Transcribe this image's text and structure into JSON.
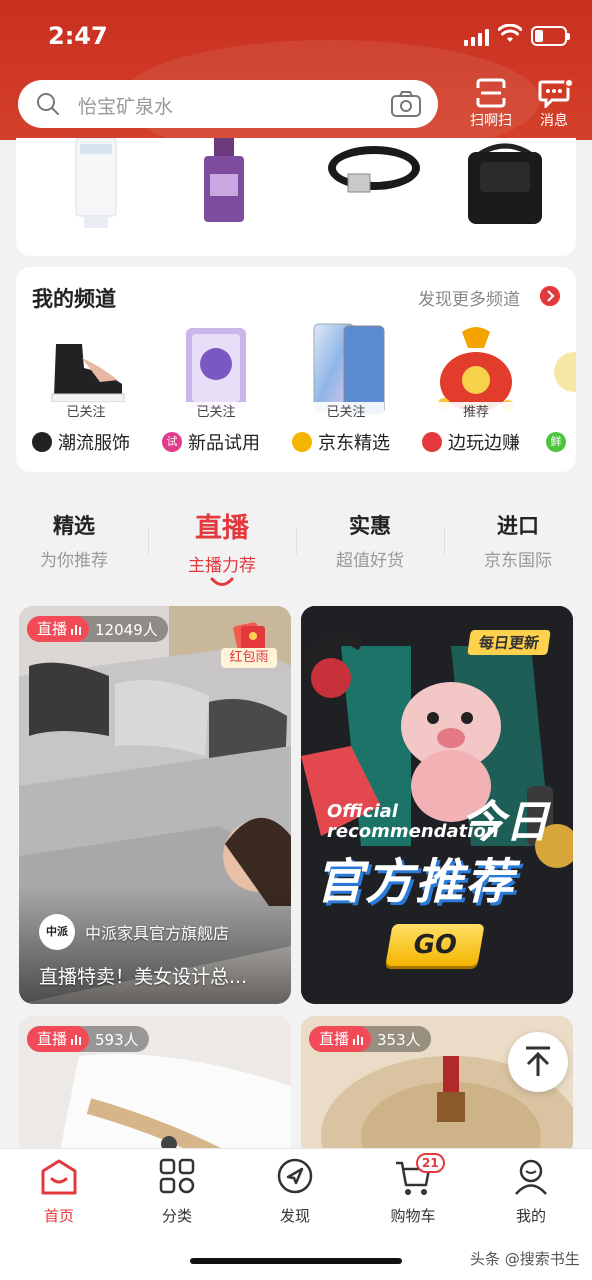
{
  "status_bar": {
    "time": "2:47"
  },
  "header": {
    "search_placeholder": "怡宝矿泉水",
    "scan_label": "扫啊扫",
    "message_label": "消息"
  },
  "my_channels": {
    "title": "我的频道",
    "more_label": "发现更多频道",
    "items": [
      {
        "badge": "已关注",
        "name": "潮流服饰",
        "icon_text": "",
        "icon_color": "#222222"
      },
      {
        "badge": "已关注",
        "name": "新品试用",
        "icon_text": "试",
        "icon_color": "#e03c8c"
      },
      {
        "badge": "已关注",
        "name": "京东精选",
        "icon_text": "",
        "icon_color": "#f5b400"
      },
      {
        "badge": "推荐",
        "name": "边玩边赚",
        "icon_text": "",
        "icon_color": "#e4393c"
      },
      {
        "badge": "",
        "name": "",
        "icon_text": "鲜",
        "icon_color": "#4cc43c"
      }
    ]
  },
  "tabs": [
    {
      "title": "精选",
      "subtitle": "为你推荐",
      "active": false
    },
    {
      "title": "直播",
      "subtitle": "主播力荐",
      "active": true
    },
    {
      "title": "实惠",
      "subtitle": "超值好货",
      "active": false
    },
    {
      "title": "进口",
      "subtitle": "京东国际",
      "active": false
    }
  ],
  "live_cards": [
    {
      "tag": "直播",
      "viewers": "12049人",
      "red_envelope": "红包雨",
      "shop_logo": "中派",
      "shop_name": "中派家具官方旗舰店",
      "caption": "直播特卖！美女设计总..."
    },
    {
      "tag": "直播",
      "viewers": "593人"
    },
    {
      "tag": "直播",
      "viewers": "353人"
    }
  ],
  "promo_card": {
    "badge": "每日更新",
    "line1": "Official",
    "line2": "recommendation",
    "today": "今日",
    "main": "官方推荐",
    "go": "GO"
  },
  "bottom_nav": [
    {
      "label": "首页",
      "icon": "home-icon",
      "active": true
    },
    {
      "label": "分类",
      "icon": "category-icon",
      "active": false
    },
    {
      "label": "发现",
      "icon": "discover-icon",
      "active": false
    },
    {
      "label": "购物车",
      "icon": "cart-icon",
      "active": false,
      "badge": "21"
    },
    {
      "label": "我的",
      "icon": "profile-icon",
      "active": false
    }
  ],
  "watermark": "头条 @搜索书生",
  "colors": {
    "brand_red": "#e4393c",
    "header_red": "#d4402a"
  }
}
